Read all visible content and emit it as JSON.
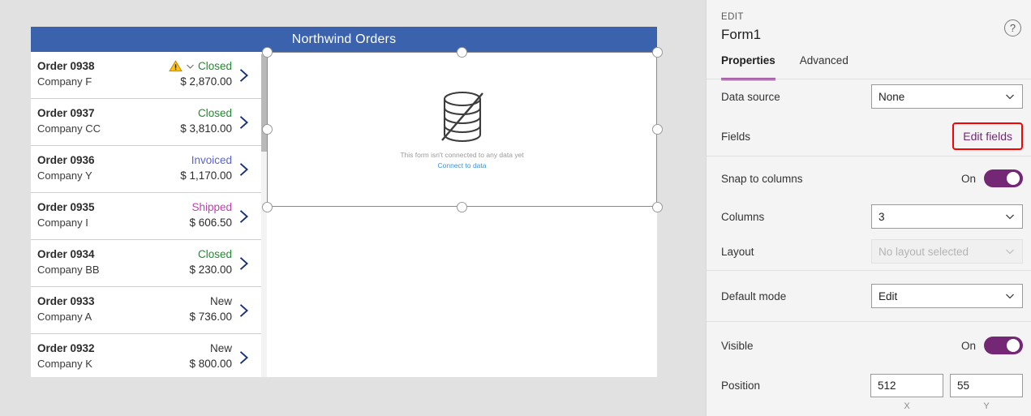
{
  "app": {
    "header_title": "Northwind Orders",
    "gallery": {
      "items": [
        {
          "title": "Order 0938",
          "company": "Company F",
          "status": "Closed",
          "status_color": "#1f8b2e",
          "amount": "$ 2,870.00",
          "has_warning": true
        },
        {
          "title": "Order 0937",
          "company": "Company CC",
          "status": "Closed",
          "status_color": "#1f8b2e",
          "amount": "$ 3,810.00",
          "has_warning": false
        },
        {
          "title": "Order 0936",
          "company": "Company Y",
          "status": "Invoiced",
          "status_color": "#5b62d6",
          "amount": "$ 1,170.00",
          "has_warning": false
        },
        {
          "title": "Order 0935",
          "company": "Company I",
          "status": "Shipped",
          "status_color": "#c13fb0",
          "amount": "$ 606.50",
          "has_warning": false
        },
        {
          "title": "Order 0934",
          "company": "Company BB",
          "status": "Closed",
          "status_color": "#1f8b2e",
          "amount": "$ 230.00",
          "has_warning": false
        },
        {
          "title": "Order 0933",
          "company": "Company A",
          "status": "New",
          "status_color": "#333333",
          "amount": "$ 736.00",
          "has_warning": false
        },
        {
          "title": "Order 0932",
          "company": "Company K",
          "status": "New",
          "status_color": "#333333",
          "amount": "$ 800.00",
          "has_warning": false
        }
      ]
    },
    "form": {
      "empty_text": "This form isn't connected to any data yet",
      "empty_link": "Connect to data"
    }
  },
  "panel": {
    "eyebrow": "EDIT",
    "title": "Form1",
    "help_glyph": "?",
    "tabs": [
      {
        "label": "Properties",
        "active": true
      },
      {
        "label": "Advanced",
        "active": false
      }
    ],
    "properties": {
      "data_source": {
        "label": "Data source",
        "value": "None"
      },
      "fields": {
        "label": "Fields",
        "action_label": "Edit fields",
        "highlight_color": "#ff0000"
      },
      "snap_to_columns": {
        "label": "Snap to columns",
        "state": "On"
      },
      "columns": {
        "label": "Columns",
        "value": "3"
      },
      "layout": {
        "label": "Layout",
        "value": "No layout selected",
        "disabled": true
      },
      "default_mode": {
        "label": "Default mode",
        "value": "Edit"
      },
      "visible": {
        "label": "Visible",
        "state": "On"
      },
      "position": {
        "label": "Position",
        "x": "512",
        "y": "55",
        "x_caption": "X",
        "y_caption": "Y"
      }
    }
  },
  "theme": {
    "header_blue": "#3b63ad",
    "accent_purple": "#742774",
    "chevron_navy": "#17307a"
  }
}
